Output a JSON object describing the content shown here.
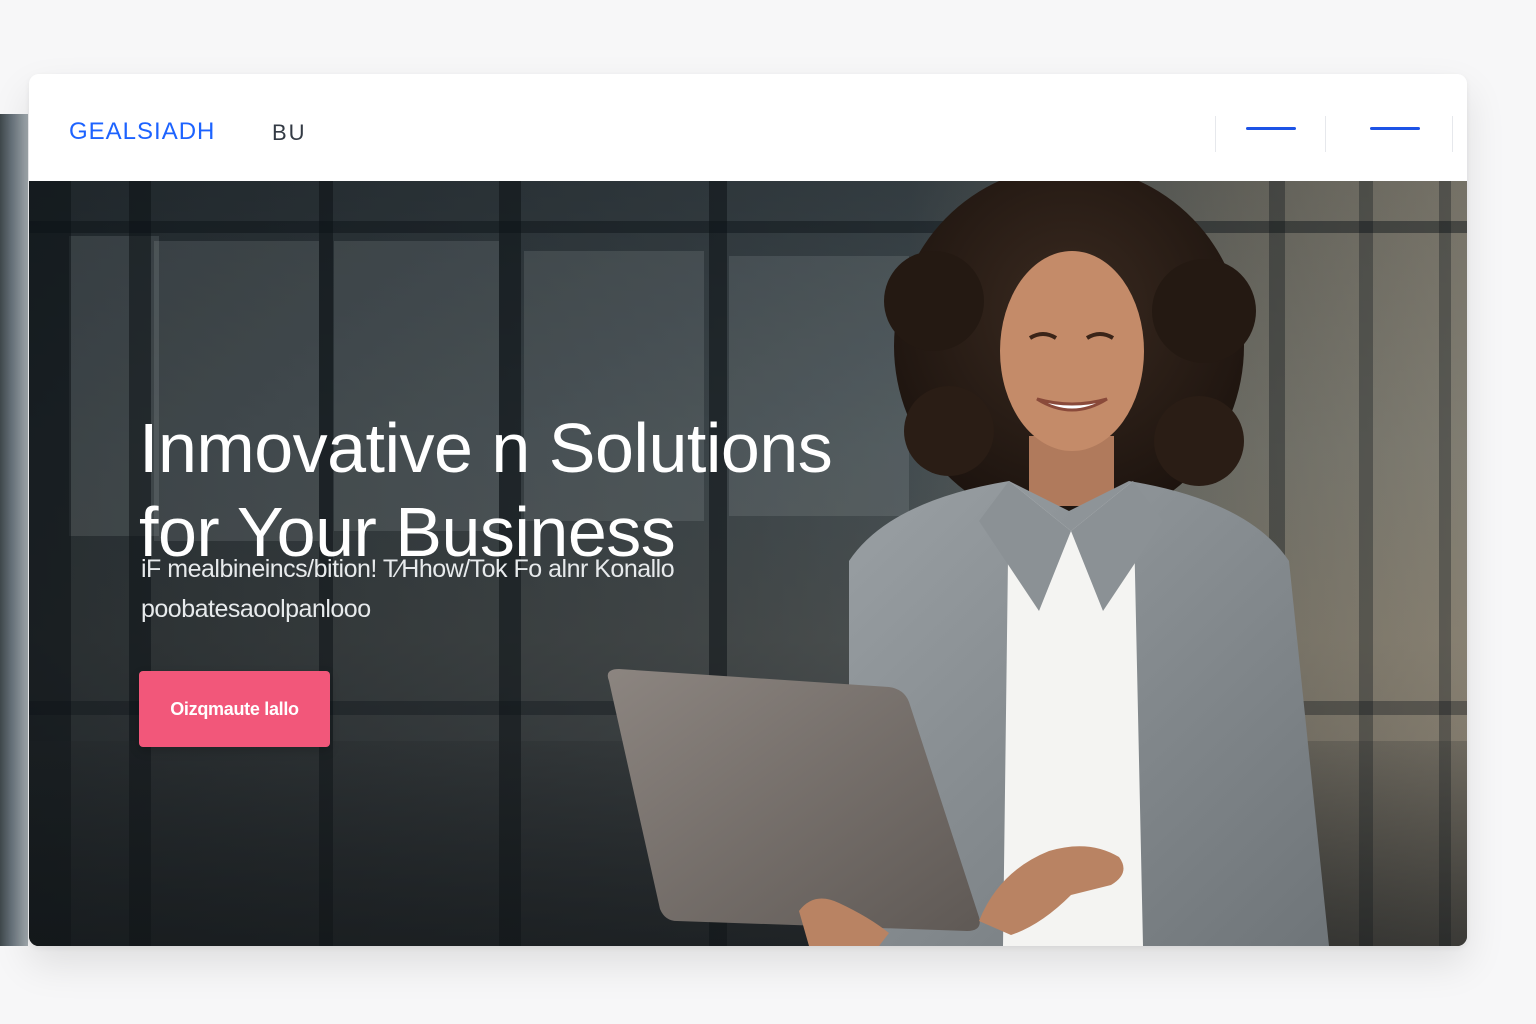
{
  "navbar": {
    "logo": "GEALSIADH",
    "link": "BU",
    "menu_icons": [
      "dash-icon",
      "dash-icon"
    ]
  },
  "hero": {
    "title_line1": "Inmovative  n Solutions",
    "title_line2": "for Your Business",
    "subtitle_line1": "iF mealbineincs/bition! T∕Hhow/Tok Fo alnr Konallo",
    "subtitle_line2": "poobatesaoolpanlooo",
    "cta_label": "Oizqmaute lallo"
  },
  "colors": {
    "accent": "#1d63ff",
    "cta": "#f2577a",
    "title": "#ffffff",
    "page_bg": "#f7f7f8"
  }
}
